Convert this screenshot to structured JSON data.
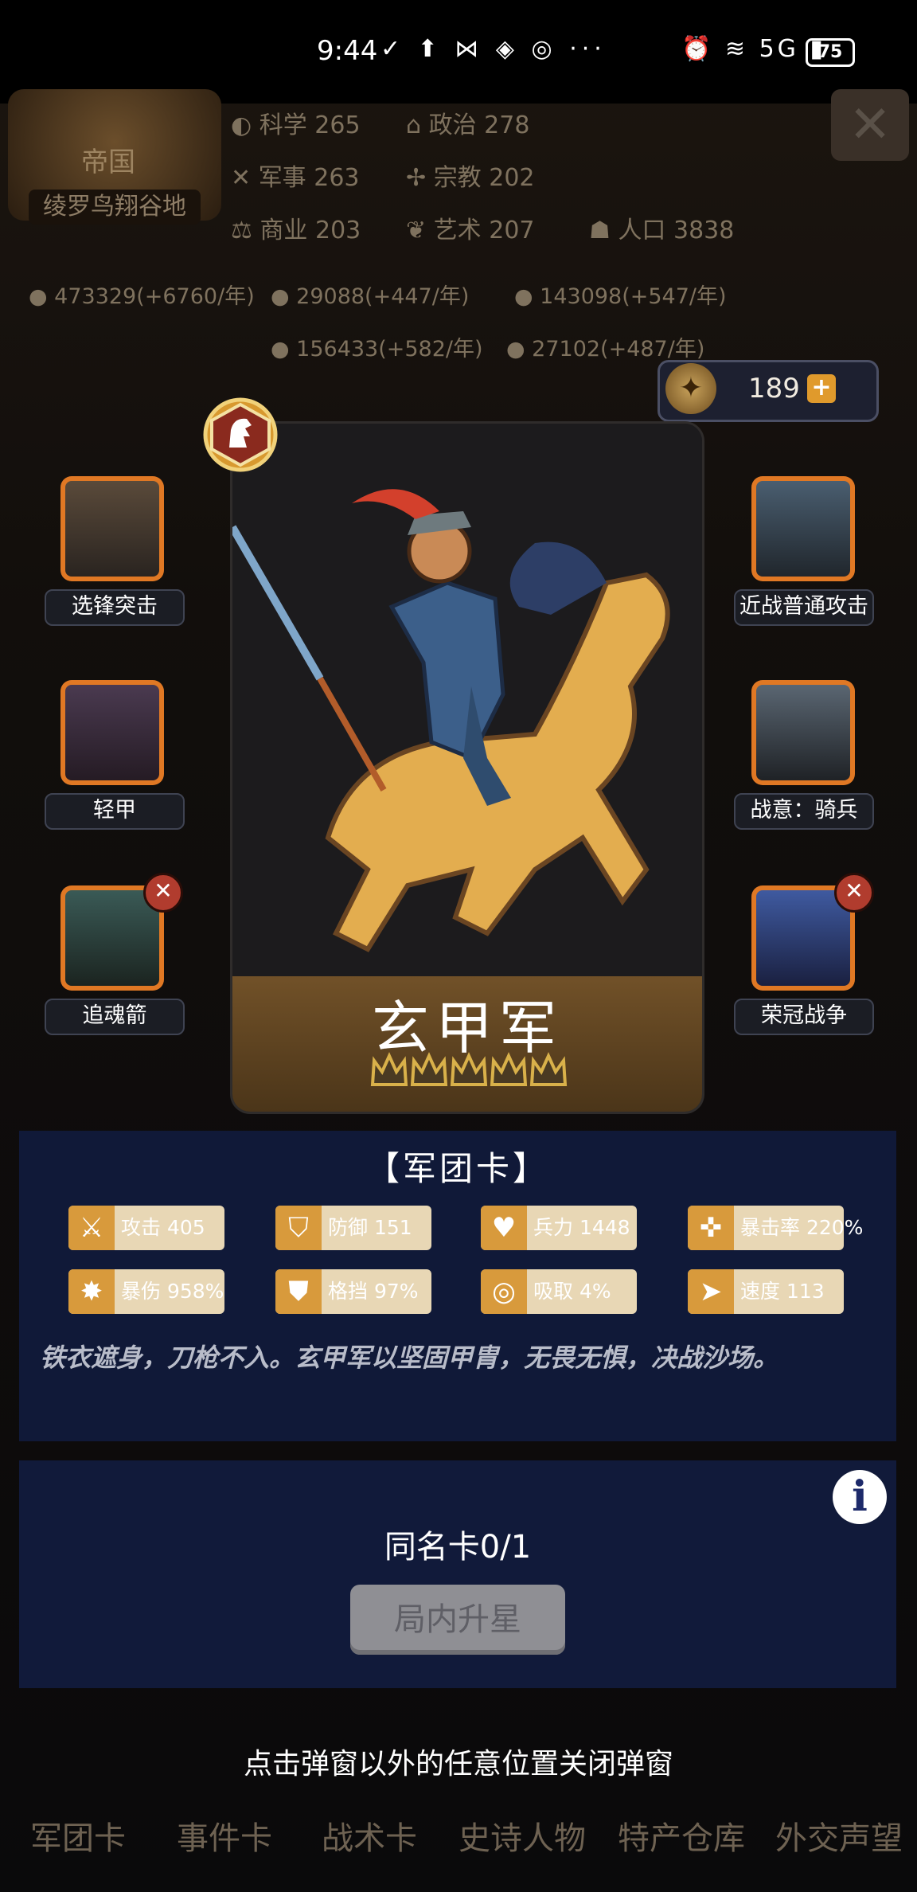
{
  "status_bar": {
    "time": "9:44",
    "battery": "75",
    "network": "5G"
  },
  "resources": {
    "region": "绫罗鸟翔谷地",
    "emblem_label": "帝国",
    "stats": [
      {
        "label": "科学",
        "value": "265"
      },
      {
        "label": "政治",
        "value": "278"
      },
      {
        "label": "军事",
        "value": "263"
      },
      {
        "label": "宗教",
        "value": "202"
      },
      {
        "label": "商业",
        "value": "203"
      },
      {
        "label": "艺术",
        "value": "207"
      },
      {
        "label": "人口",
        "value": "3838"
      }
    ],
    "income": [
      "473329(+6760/年)",
      "29088(+447/年)",
      "143098(+547/年)",
      "156433(+582/年)",
      "27102(+487/年)"
    ]
  },
  "currency": {
    "value": "189"
  },
  "card": {
    "name": "玄甲军",
    "stars": 5,
    "type_label": "【军团卡】"
  },
  "skills_left": [
    {
      "label": "选锋突击",
      "removable": false
    },
    {
      "label": "轻甲",
      "removable": false
    },
    {
      "label": "追魂箭",
      "removable": true
    }
  ],
  "skills_right": [
    {
      "label": "近战普通攻击",
      "removable": false
    },
    {
      "label": "战意：骑兵",
      "removable": false
    },
    {
      "label": "荣冠战争",
      "removable": true
    }
  ],
  "stats": [
    {
      "name": "攻击",
      "value": "405",
      "icon": "sword-icon"
    },
    {
      "name": "防御",
      "value": "151",
      "icon": "shield-icon"
    },
    {
      "name": "兵力",
      "value": "1448",
      "icon": "heart-icon"
    },
    {
      "name": "暴击率",
      "value": "220%",
      "icon": "crosshair-icon"
    },
    {
      "name": "暴伤",
      "value": "958%",
      "icon": "burst-icon"
    },
    {
      "name": "格挡",
      "value": "97%",
      "icon": "block-icon"
    },
    {
      "name": "吸取",
      "value": "4%",
      "icon": "drain-icon"
    },
    {
      "name": "速度",
      "value": "113",
      "icon": "boot-icon"
    }
  ],
  "description": "铁衣遮身，刀枪不入。玄甲军以坚固甲胄，无畏无惧，决战沙场。",
  "duplicate": "同名卡0/1",
  "upgrade_button": "局内升星",
  "hint": "点击弹窗以外的任意位置关闭弹窗",
  "bottom_nav": [
    "军团卡",
    "事件卡",
    "战术卡",
    "史诗人物",
    "特产仓库",
    "外交声望"
  ],
  "colors": {
    "accent": "#e07824",
    "panel": "#111a3a",
    "card_banner": "#715128"
  }
}
